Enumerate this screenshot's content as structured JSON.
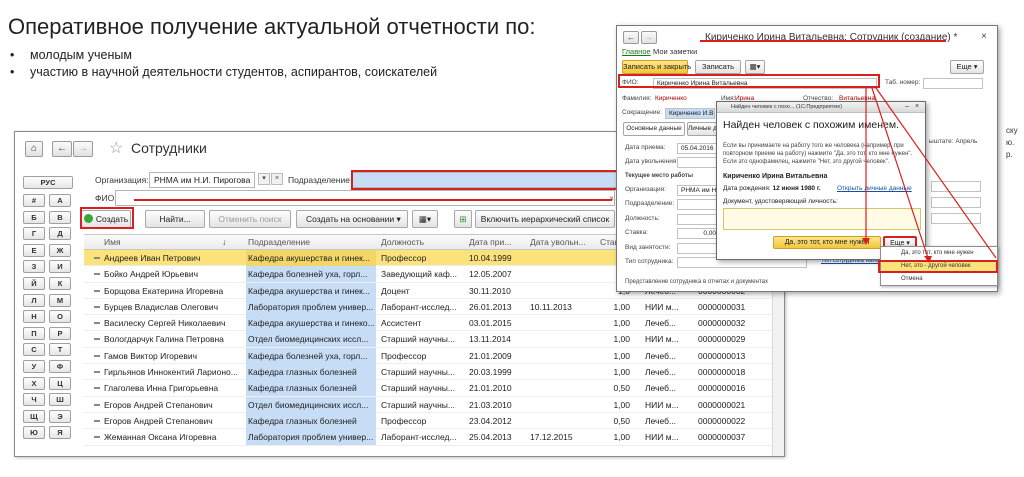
{
  "slide": {
    "title": "Оперативное получение актуальной отчетности по:",
    "bullets": [
      "молодым ученым",
      "участию в научной деятельности студентов, аспирантов, соискателей"
    ]
  },
  "main": {
    "title": "Сотрудники",
    "nav": {
      "home": "⌂",
      "back": "←",
      "forward": "→"
    },
    "filters": {
      "org_label": "Организация:",
      "org_value": "РНМА им Н.И. Пирогова",
      "dept_label": "Подразделение:",
      "fio_label": "ФИО:"
    },
    "toolbar": {
      "create": "Создать",
      "find": "Найти...",
      "cancel_search": "Отменить поиск",
      "create_based": "Создать на основании",
      "hierarchy": "Включить иерархический список"
    },
    "alphabet": [
      "РУС",
      "#",
      "А",
      "Б",
      "В",
      "Г",
      "Д",
      "Е",
      "Ж",
      "З",
      "И",
      "Й",
      "К",
      "Л",
      "М",
      "Н",
      "О",
      "П",
      "Р",
      "С",
      "Т",
      "У",
      "Ф",
      "Х",
      "Ц",
      "Ч",
      "Ш",
      "Щ",
      "Э",
      "Ю",
      "Я"
    ],
    "columns": [
      "Имя",
      "Подразделение",
      "Должность",
      "Дата при...",
      "Дата увольн...",
      "Став"
    ],
    "rows": [
      {
        "name": "Андреев Иван Петрович",
        "dept": "Кафедра акушерства и гинек...",
        "pos": "Профессор",
        "hire": "10.04.1999",
        "fire": "",
        "rate": "1,0",
        "extra1": "",
        "extra2": ""
      },
      {
        "name": "Бойко Андрей Юрьевич",
        "dept": "Кафедра болезней уха, горл...",
        "pos": "Заведующий каф...",
        "hire": "12.05.2007",
        "fire": "",
        "rate": "1,0",
        "extra1": "",
        "extra2": ""
      },
      {
        "name": "Борщова Екатерина Игоревна",
        "dept": "Кафедра акушерства и гинек...",
        "pos": "Доцент",
        "hire": "30.11.2010",
        "fire": "",
        "rate": "1,0",
        "extra1": "Лечеб...",
        "extra2": "0000000002"
      },
      {
        "name": "Бурцев Владислав Олегович",
        "dept": "Лаборатория проблем универ...",
        "pos": "Лаборант-исслед...",
        "hire": "26.01.2013",
        "fire": "10.11.2013",
        "rate": "1,00",
        "extra1": "НИИ м...",
        "extra2": "0000000031"
      },
      {
        "name": "Василеску Сергей Николаевич",
        "dept": "Кафедра акушерства и гинеко...",
        "pos": "Ассистент",
        "hire": "03.01.2015",
        "fire": "",
        "rate": "1,00",
        "extra1": "Лечеб...",
        "extra2": "0000000032"
      },
      {
        "name": "Вологдарчук Галина Петровна",
        "dept": "Отдел биомедицинских иссл...",
        "pos": "Старший научны...",
        "hire": "13.11.2014",
        "fire": "",
        "rate": "1,00",
        "extra1": "НИИ м...",
        "extra2": "0000000029"
      },
      {
        "name": "Гамов Виктор Игоревич",
        "dept": "Кафедра болезней уха, горл...",
        "pos": "Профессор",
        "hire": "21.01.2009",
        "fire": "",
        "rate": "1,00",
        "extra1": "Лечеб...",
        "extra2": "0000000013"
      },
      {
        "name": "Гирльянов Иннокентий Ларионо...",
        "dept": "Кафедра глазных болезней",
        "pos": "Старший научны...",
        "hire": "20.03.1999",
        "fire": "",
        "rate": "1,00",
        "extra1": "Лечеб...",
        "extra2": "0000000018"
      },
      {
        "name": "Глаголева Инна Григорьевна",
        "dept": "Кафедра глазных болезней",
        "pos": "Старший научны...",
        "hire": "21.01.2010",
        "fire": "",
        "rate": "0,50",
        "extra1": "Лечеб...",
        "extra2": "0000000016"
      },
      {
        "name": "Егоров Андрей Степанович",
        "dept": "Отдел биомедицинских иссл...",
        "pos": "Старший научны...",
        "hire": "21.03.2010",
        "fire": "",
        "rate": "1,00",
        "extra1": "НИИ м...",
        "extra2": "0000000021"
      },
      {
        "name": "Егоров Андрей Степанович",
        "dept": "Кафедра глазных болезней",
        "pos": "Профессор",
        "hire": "23.04.2012",
        "fire": "",
        "rate": "0,50",
        "extra1": "Лечеб...",
        "extra2": "0000000022"
      },
      {
        "name": "Жеманная Оксана Игоревна",
        "dept": "Лаборатория проблем универ...",
        "pos": "Лаборант-исслед...",
        "hire": "25.04.2013",
        "fire": "17.12.2015",
        "rate": "1,00",
        "extra1": "НИИ м...",
        "extra2": "0000000037"
      }
    ]
  },
  "overlay": {
    "title": "Кириченко Ирина Витальевна: Сотрудник (создание) *",
    "links": {
      "home": "Главное",
      "notes": "Мои заметки"
    },
    "buttons": {
      "save_close": "Записать и закрыть",
      "save": "Записать",
      "more": "Еще ▾"
    },
    "fio_label": "ФИО:",
    "fio_value": "Кириченко Ирина Витальевна",
    "tab_label": "Таб. номер:",
    "surname_label": "Фамилия:",
    "surname_value": "Кириченко",
    "name_label": "Имя:",
    "name_value": "Ирина",
    "patr_label": "Отчество:",
    "patr_value": "Витальевна",
    "short_label": "Сокращение:",
    "short_value": "Кириченко И.В.",
    "tabs": [
      "Основные данные",
      "Личные д"
    ],
    "form": [
      {
        "label": "Дата приема:",
        "value": "05.04.2016"
      },
      {
        "label": "Дата увольнения:",
        "value": ""
      },
      {
        "label": "Текущее место работы",
        "value": ""
      },
      {
        "label": "Организация:",
        "value": "РНМА им Н.И."
      },
      {
        "label": "Подразделение:",
        "value": ""
      },
      {
        "label": "Должность:",
        "value": ""
      },
      {
        "label": "Ставка:",
        "value": "0,00"
      },
      {
        "label": "Вид занятости:",
        "value": ""
      },
      {
        "label": "Тип сотрудника:",
        "value": ""
      }
    ],
    "type_link": "Тип сотрудника наим",
    "repr": "Представление сотрудника в отчетах и документах",
    "side_text": "ыштате: Апрель"
  },
  "dialog": {
    "bar": "Найден человек с похо...  (1С:Предприятие)",
    "title": "Найден человек с похожим именем.",
    "text": "Если вы принимаете на работу того же человека (например, при повторном приеме на работу) нажмите \"Да, это тот, кто мне нужен\". Если это однофамилец, нажмите \"Нет, это другой человек\".",
    "person": "Кириченко Ирина Витальевна",
    "dob_label": "Дата рождения:",
    "dob": "12 июня 1980 г.",
    "open_link": "Открыть личные данные",
    "doc_label": "Документ, удостоверяющий личность:",
    "yes": "Да, это тот, кто мне нужен",
    "more": "Еще ▾"
  },
  "dropdown": [
    "Да, это тот, кто мне нужен",
    "Нет, это - другой человек",
    "Отмена"
  ],
  "right_partial": [
    "ску",
    "ю.",
    "р."
  ]
}
